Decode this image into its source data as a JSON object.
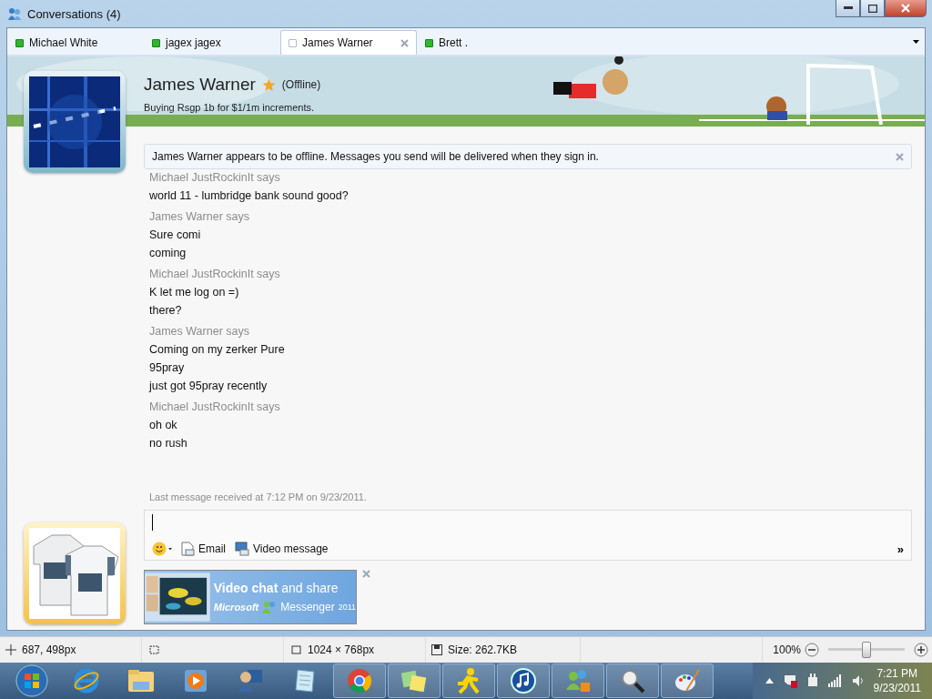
{
  "window": {
    "title": "Conversations (4)"
  },
  "tabs": [
    {
      "label": "Michael White",
      "online": true,
      "selected": false
    },
    {
      "label": "jagex jagex",
      "online": true,
      "selected": false
    },
    {
      "label": "James Warner",
      "online": false,
      "selected": true
    },
    {
      "label": "Brett .",
      "online": true,
      "selected": false
    }
  ],
  "contact": {
    "name": "James Warner",
    "favorite": true,
    "status": "(Offline)",
    "message": "Buying Rsgp 1b for $1/1m increments."
  },
  "notice": "James Warner appears to be offline. Messages you send will be delivered when they sign in.",
  "messages": [
    {
      "sender": "Michael JustRockinIt says",
      "lines": [
        "world 11 - lumbridge bank sound good?"
      ]
    },
    {
      "sender": "James Warner says",
      "lines": [
        "Sure comi",
        "coming"
      ]
    },
    {
      "sender": "Michael JustRockinIt says",
      "lines": [
        "K let me log on =)",
        "there?"
      ]
    },
    {
      "sender": "James Warner says",
      "lines": [
        "Coming on my zerker Pure",
        "95pray",
        "just got 95pray recently"
      ]
    },
    {
      "sender": "Michael JustRockinIt says",
      "lines": [
        "oh ok",
        "no rush"
      ]
    }
  ],
  "last_message": "Last message received at 7:12 PM on 9/23/2011.",
  "composer": {
    "actions": [
      "Email",
      "Video message"
    ],
    "more": "»"
  },
  "ad": {
    "headline": "**Video chat** and share",
    "brand": "Microsoft",
    "product": "Messenger",
    "year": "2011"
  },
  "status_bar": {
    "cursor": "687, 498px",
    "dimensions": "1024 × 768px",
    "size": "Size: 262.7KB",
    "zoom": "100%",
    "zoom_slider": {
      "level": 0.5
    }
  },
  "taskbar": {
    "time": "7:21 PM",
    "date": "9/23/2011"
  }
}
